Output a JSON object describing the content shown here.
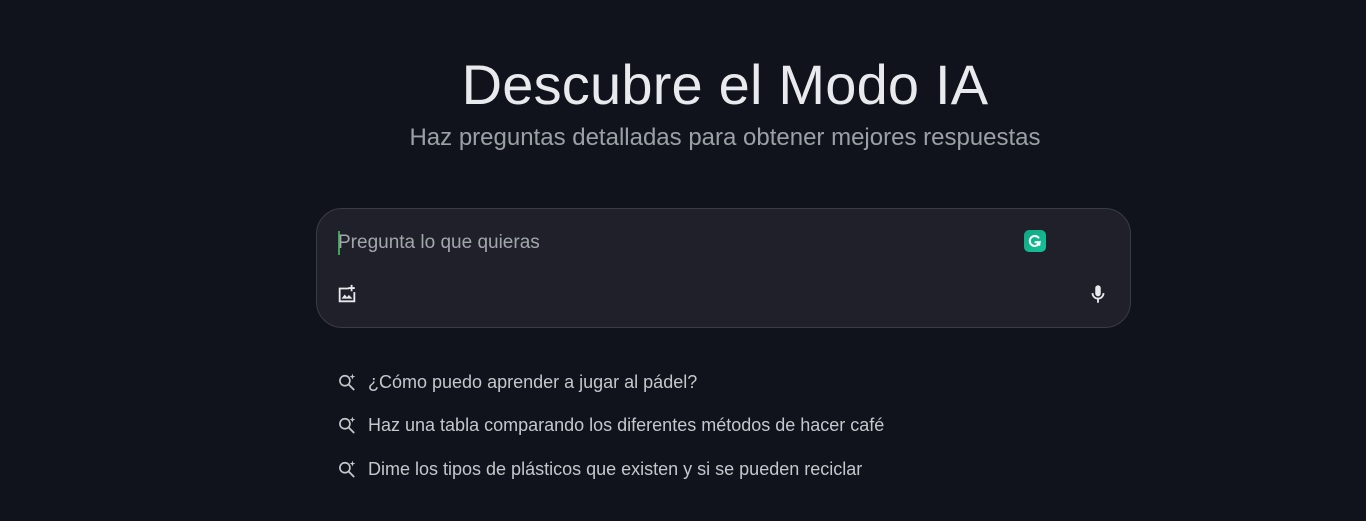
{
  "hero": {
    "title": "Descubre el Modo IA",
    "subtitle": "Haz preguntas detalladas para obtener mejores respuestas"
  },
  "search": {
    "placeholder": "Pregunta lo que quieras",
    "value": "",
    "icons": {
      "extension": "grammarly-icon",
      "add_image": "add-image-icon",
      "voice": "microphone-icon"
    }
  },
  "suggestions": [
    {
      "icon": "search-sparkle-icon",
      "text": "¿Cómo puedo aprender a jugar al pádel?"
    },
    {
      "icon": "search-sparkle-icon",
      "text": "Haz una tabla comparando los diferentes métodos de hacer café"
    },
    {
      "icon": "search-sparkle-icon",
      "text": "Dime los tipos de plásticos que existen y si se pueden reciclar"
    }
  ],
  "colors": {
    "background": "#10131b",
    "box": "#1f2029",
    "accent": "#15c39a"
  }
}
